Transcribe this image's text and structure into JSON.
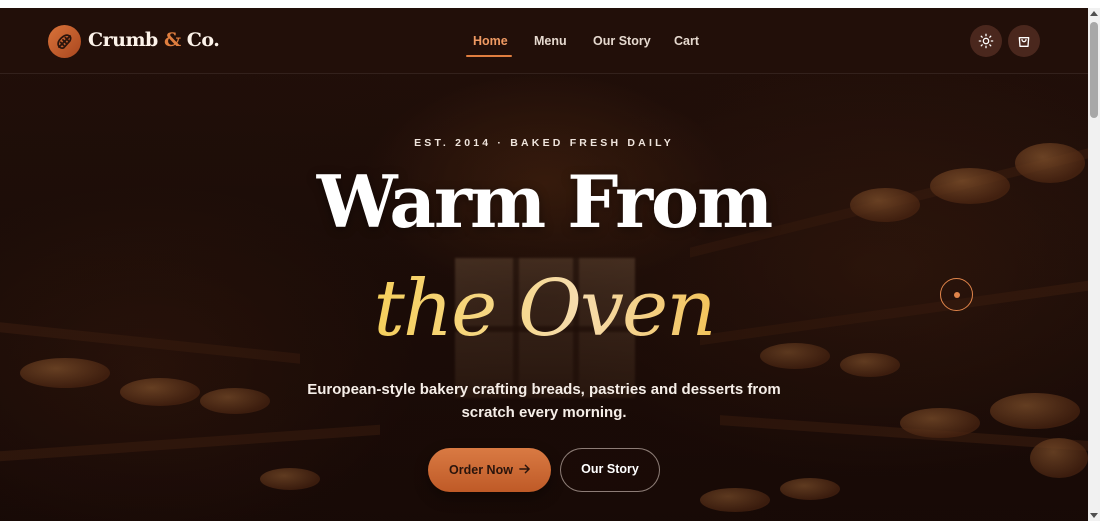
{
  "navbar": {
    "brand_main": "Crumb",
    "brand_amp": "&",
    "brand_tail": "Co.",
    "logo_icon": "bread-icon",
    "links": [
      {
        "label": "Home",
        "active": true
      },
      {
        "label": "Menu",
        "active": false
      },
      {
        "label": "Our Story",
        "active": false
      },
      {
        "label": "Cart",
        "active": false
      }
    ],
    "theme_toggle_icon": "sun-icon",
    "cart_icon": "shopping-bag-icon"
  },
  "hero": {
    "eyebrow": "EST. 2014 · BAKED FRESH DAILY",
    "headline_line1": "Warm From",
    "headline_line2": "the Oven",
    "subtitle": "European-style bakery crafting breads, pastries and desserts from scratch every morning.",
    "primary_cta": "Order Now",
    "primary_cta_icon": "arrow-right-icon",
    "secondary_cta": "Our Story"
  },
  "colors": {
    "accent": "#e07e3f",
    "headline_gold": "#f5cf5c",
    "background": "#1e0e0a"
  }
}
